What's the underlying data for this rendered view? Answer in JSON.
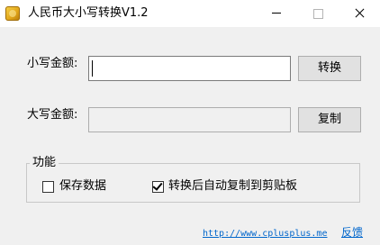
{
  "window": {
    "title": "人民币大小写转换V1.2",
    "icon": "coin-icon"
  },
  "form": {
    "lowercase_label": "小写金额:",
    "lowercase_value": "",
    "lowercase_placeholder": "",
    "convert_button": "转换",
    "uppercase_label": "大写金额:",
    "uppercase_value": "",
    "copy_button": "复制"
  },
  "functions": {
    "group_title": "功能",
    "save_data_label": "保存数据",
    "save_data_checked": false,
    "auto_copy_label": "转换后自动复制到剪贴板",
    "auto_copy_checked": true
  },
  "footer": {
    "website": "http://www.cplusplus.me",
    "feedback": "反馈"
  },
  "colors": {
    "link": "#0066cc",
    "window_bg": "#f0f0f0",
    "titlebar_bg": "#ffffff"
  }
}
